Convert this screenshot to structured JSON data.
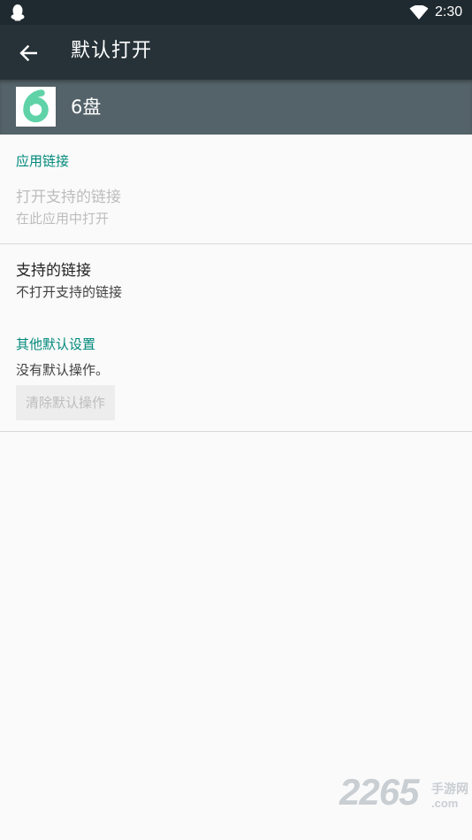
{
  "status_bar": {
    "time": "2:30",
    "left_icon": "qq-penguin-icon",
    "right_icon": "wifi-icon"
  },
  "app_bar": {
    "title": "默认打开",
    "back_icon": "arrow-left-icon"
  },
  "app_header": {
    "icon_glyph": "6",
    "icon_color": "#5fd3a7",
    "name": "6盘"
  },
  "sections": {
    "app_links": {
      "title": "应用链接",
      "open_supported_links": {
        "label": "打开支持的链接",
        "summary": "在此应用中打开"
      },
      "supported_links": {
        "label": "支持的链接",
        "summary": "不打开支持的链接"
      }
    },
    "other_defaults": {
      "title": "其他默认设置",
      "summary": "没有默认操作。",
      "clear_button": "清除默认操作"
    }
  },
  "watermark": {
    "digits": "2265",
    "site": "手游网",
    "domain": ".com"
  },
  "colors": {
    "status_bar": "#1f2a30",
    "app_bar": "#263238",
    "app_header": "#546269",
    "accent": "#00897b",
    "background": "#fafafa"
  }
}
